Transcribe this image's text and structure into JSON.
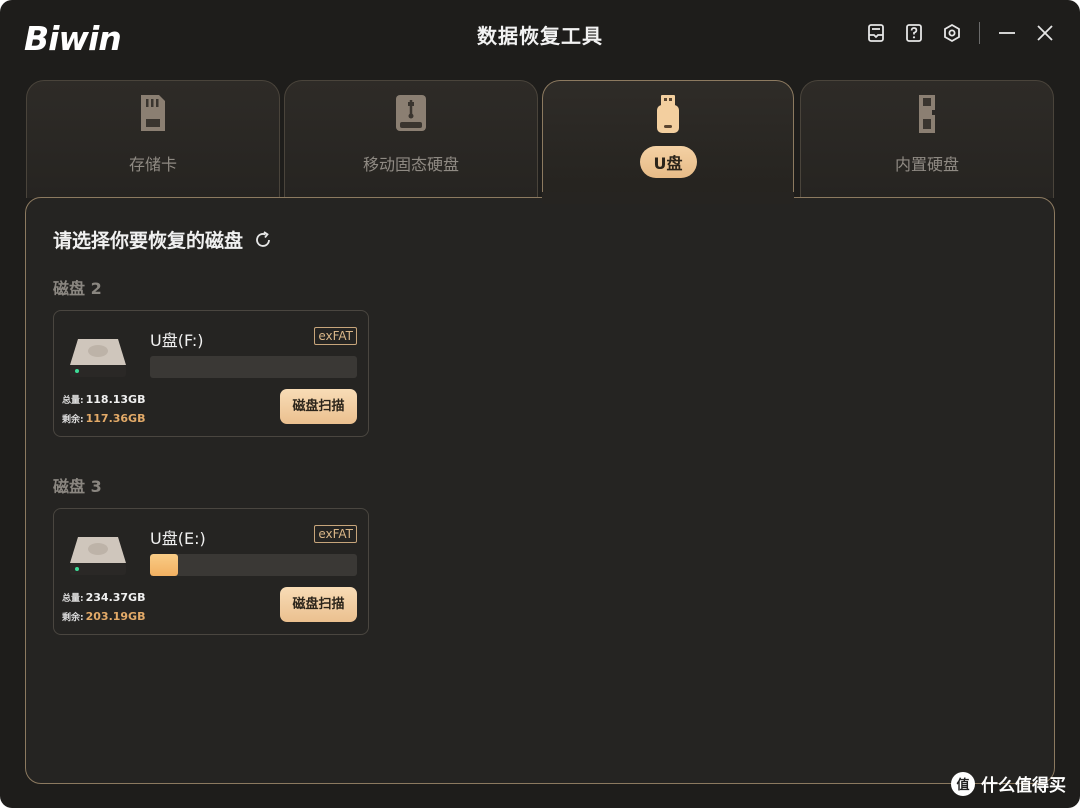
{
  "app": {
    "brand": "Biwin",
    "title": "数据恢复工具"
  },
  "title_icons": [
    "feedback-icon",
    "help-icon",
    "settings-icon",
    "minimize-icon",
    "close-icon"
  ],
  "tabs": [
    {
      "label": "存储卡",
      "icon": "sd-card-icon",
      "active": false
    },
    {
      "label": "移动固态硬盘",
      "icon": "portable-ssd-icon",
      "active": false
    },
    {
      "label": "U盘",
      "icon": "usb-drive-icon",
      "active": true
    },
    {
      "label": "内置硬盘",
      "icon": "internal-ssd-icon",
      "active": false
    }
  ],
  "main": {
    "heading": "请选择你要恢复的磁盘",
    "disks": [
      {
        "group": "磁盘 2",
        "name": "U盘(F:)",
        "filesystem": "exFAT",
        "usage_fraction": 0.0065,
        "total_label": "总量:",
        "total": "118.13GB",
        "free_label": "剩余:",
        "free": "117.36GB",
        "scan_label": "磁盘扫描"
      },
      {
        "group": "磁盘 3",
        "name": "U盘(E:)",
        "filesystem": "exFAT",
        "usage_fraction": 0.133,
        "total_label": "总量:",
        "total": "234.37GB",
        "free_label": "剩余:",
        "free": "203.19GB",
        "scan_label": "磁盘扫描"
      }
    ]
  },
  "watermark": {
    "text": "什么值得买",
    "logo_glyph": "值"
  },
  "colors": {
    "accent": "#e7bb87",
    "panel_border": "#8c7a60",
    "window_bg": "#1e1d1b"
  }
}
